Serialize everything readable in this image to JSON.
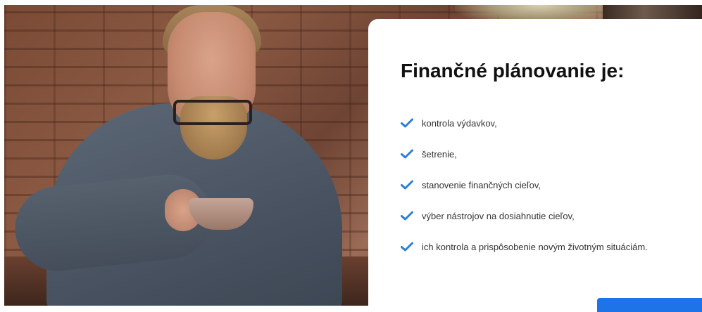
{
  "card": {
    "title": "Finančné plánovanie je:",
    "items": [
      "kontrola výdavkov,",
      "šetrenie,",
      "stanovenie finančných cieľov,",
      "výber nástrojov na dosiahnutie cieľov,",
      "ich kontrola a prispôsobenie novým životným situáciám."
    ],
    "check_icon": "check-icon",
    "check_color": "#2d7fd3",
    "cta_color": "#1e73e8"
  }
}
